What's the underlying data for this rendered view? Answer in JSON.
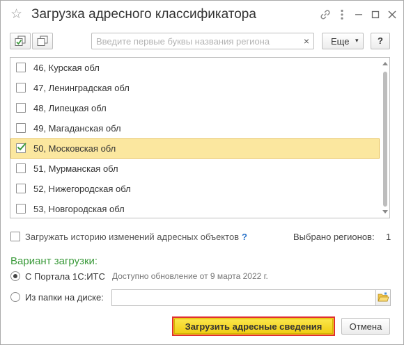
{
  "window": {
    "title": "Загрузка адресного классификатора"
  },
  "toolbar": {
    "search_placeholder": "Введите первые буквы названия региона",
    "search_value": "",
    "clear_glyph": "×",
    "more_label": "Еще",
    "more_caret": "▾",
    "help_label": "?"
  },
  "regions": [
    {
      "label": "46, Курская обл",
      "checked": false
    },
    {
      "label": "47, Ленинградская обл",
      "checked": false
    },
    {
      "label": "48, Липецкая обл",
      "checked": false
    },
    {
      "label": "49, Магаданская обл",
      "checked": false
    },
    {
      "label": "50, Московская обл",
      "checked": true
    },
    {
      "label": "51, Мурманская обл",
      "checked": false
    },
    {
      "label": "52, Нижегородская обл",
      "checked": false
    },
    {
      "label": "53, Новгородская обл",
      "checked": false
    }
  ],
  "options": {
    "history_label": "Загружать историю изменений адресных объектов",
    "history_checked": false,
    "history_help": "?",
    "selected_label": "Выбрано регионов:",
    "selected_count": "1"
  },
  "load_variant": {
    "title": "Вариант загрузки:",
    "portal_label": "С Портала 1С:ИТС",
    "portal_checked": true,
    "portal_note": "Доступно обновление от 9 марта 2022 г.",
    "folder_label": "Из папки на диске:",
    "folder_checked": false,
    "folder_value": ""
  },
  "buttons": {
    "load_label": "Загрузить адресные сведения",
    "cancel_label": "Отмена"
  },
  "colors": {
    "accent_green": "#3c9b3c",
    "selected_row": "#fbe79f",
    "primary_button": "#f6d92a",
    "highlight_border": "#e03030",
    "checkmark": "#3c9b3c",
    "help_blue": "#2a73c9"
  },
  "icons": {
    "favorite": "star-icon",
    "link": "link-icon",
    "menu": "more-vertical-icon",
    "minimize": "minimize-icon",
    "close": "close-icon",
    "check_all": "check-all-icon",
    "copy": "copy-icon",
    "folder": "folder-open-icon"
  }
}
